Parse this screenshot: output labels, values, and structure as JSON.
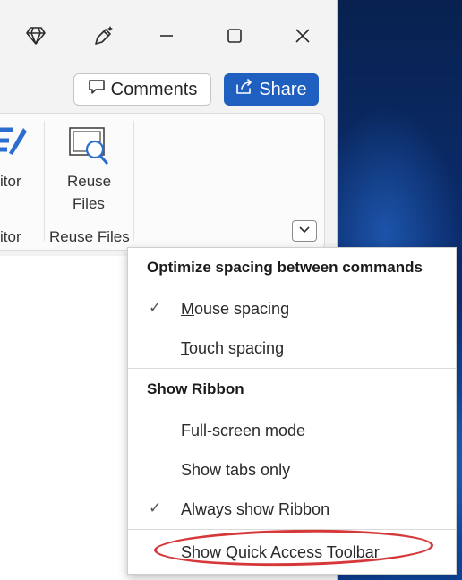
{
  "ribbon": {
    "editor_partial": "itor",
    "editor_group_partial": "itor",
    "reuse_files": {
      "label_line1": "Reuse",
      "label_line2": "Files",
      "group_label": "Reuse Files"
    }
  },
  "toolbar": {
    "comments_label": "Comments",
    "share_label": "Share"
  },
  "menu": {
    "heading_spacing": "Optimize spacing between commands",
    "mouse_spacing": {
      "first": "M",
      "rest": "ouse spacing",
      "checked": true
    },
    "touch_spacing": {
      "first": "T",
      "rest": "ouch spacing",
      "checked": false
    },
    "heading_ribbon": "Show Ribbon",
    "full_screen_mode": "Full-screen mode",
    "show_tabs_only": "Show tabs only",
    "always_show_ribbon": {
      "label": "Always show Ribbon",
      "checked": true
    },
    "show_qat": {
      "first": "S",
      "rest": "how Quick Access Toolbar"
    },
    "check_glyph": "✓"
  },
  "colors": {
    "share_bg": "#1f5fbf",
    "highlight_oval": "#d6383a"
  }
}
